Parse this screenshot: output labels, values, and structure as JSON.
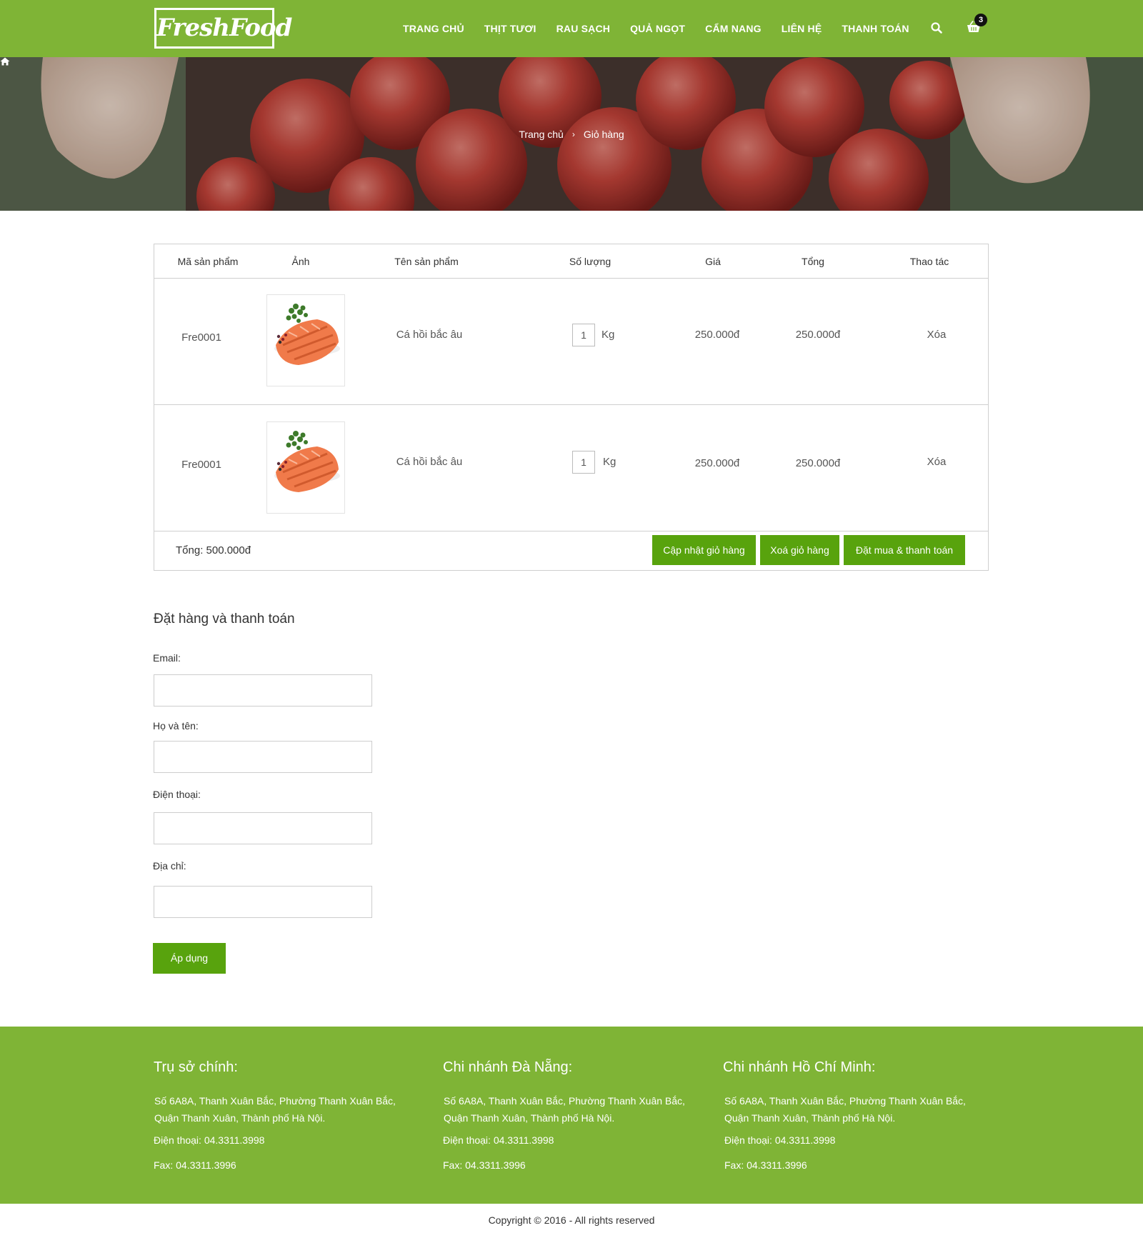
{
  "header": {
    "logo_text": "FreshFood",
    "nav": [
      "TRANG CHỦ",
      "THỊT TƯƠI",
      "RAU SẠCH",
      "QUẢ NGỌT",
      "CẨM NANG",
      "LIÊN HỆ",
      "THANH TOÁN"
    ],
    "search_icon": "search-icon",
    "cart_icon": "shopping-basket-icon",
    "cart_count": "3"
  },
  "breadcrumb": {
    "home_icon": "home-icon",
    "home": "Trang chủ",
    "separator": "›",
    "current": "Giỏ hàng"
  },
  "cart": {
    "headers": [
      "Mã sản phẩm",
      "Ảnh",
      "Tên sản phẩm",
      "Số lượng",
      "Giá",
      "Tổng",
      "Thao tác"
    ],
    "rows": [
      {
        "code": "Fre0001",
        "image": "salmon-fillet-image",
        "name": "Cá hồi bắc âu",
        "qty": "1",
        "unit": "Kg",
        "price": "250.000đ",
        "total": "250.000đ",
        "action": "Xóa"
      },
      {
        "code": "Fre0001",
        "image": "salmon-fillet-image",
        "name": "Cá hồi bắc âu",
        "qty": "1",
        "unit": "Kg",
        "price": "250.000đ",
        "total": "250.000đ",
        "action": "Xóa"
      }
    ],
    "total_label": "Tổng: 500.000đ",
    "update_button": "Cập nhật giỏ hàng",
    "clear_button": "Xoá giỏ hàng",
    "checkout_button": "Đặt mua & thanh toán"
  },
  "checkout": {
    "title": "Đặt hàng và thanh toán",
    "email_label": "Email:",
    "email_value": "",
    "name_label": "Họ và tên:",
    "name_value": "",
    "phone_label": "Điện thoại:",
    "phone_value": "",
    "address_label": "Địa chỉ:",
    "address_value": "",
    "apply_button": "Áp dụng"
  },
  "footer": {
    "columns": [
      {
        "title": "Trụ sở chính:",
        "address": "Số 6A8A, Thanh Xuân Bắc, Phường Thanh Xuân Bắc, Quận Thanh Xuân, Thành phố Hà Nội.",
        "phone": "Điện thoại: 04.3311.3998",
        "fax": "Fax: 04.3311.3996"
      },
      {
        "title": "Chi nhánh Đà Nẵng:",
        "address": "Số 6A8A, Thanh Xuân Bắc, Phường Thanh Xuân Bắc, Quận Thanh Xuân, Thành phố Hà Nội.",
        "phone": "Điện thoại: 04.3311.3998",
        "fax": "Fax: 04.3311.3996"
      },
      {
        "title": "Chi nhánh Hồ Chí Minh:",
        "address": "Số 6A8A, Thanh Xuân Bắc, Phường Thanh Xuân Bắc, Quận Thanh Xuân, Thành phố Hà Nội.",
        "phone": "Điện thoại: 04.3311.3998",
        "fax": "Fax: 04.3311.3996"
      }
    ],
    "copyright": "Copyright © 2016 - All rights reserved"
  },
  "colors": {
    "brand_green": "#7fb436",
    "button_green": "#58a30d"
  }
}
